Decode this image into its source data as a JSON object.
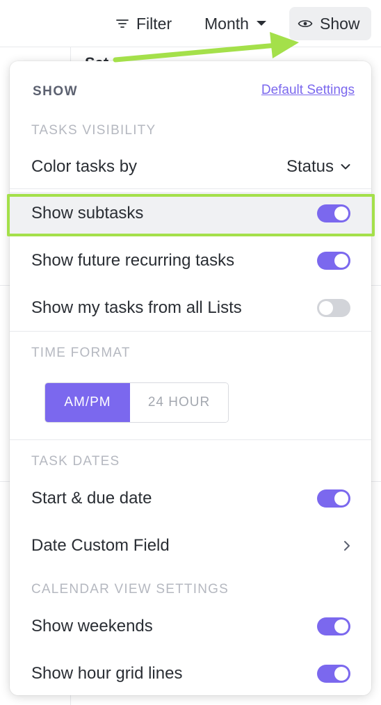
{
  "toolbar": {
    "filter_label": "Filter",
    "month_label": "Month",
    "show_label": "Show"
  },
  "background": {
    "day_label": "Sat"
  },
  "panel": {
    "title": "SHOW",
    "default_settings_link": "Default Settings",
    "tasks_visibility": {
      "heading": "TASKS VISIBILITY",
      "color_tasks_by": {
        "label": "Color tasks by",
        "value": "Status"
      },
      "show_subtasks": {
        "label": "Show subtasks",
        "on": true
      },
      "show_future_recurring": {
        "label": "Show future recurring tasks",
        "on": true
      },
      "show_my_tasks_all_lists": {
        "label": "Show my tasks from all Lists",
        "on": false
      }
    },
    "time_format": {
      "heading": "TIME FORMAT",
      "options": [
        "AM/PM",
        "24 HOUR"
      ],
      "selected": "AM/PM"
    },
    "task_dates": {
      "heading": "TASK DATES",
      "start_due_date": {
        "label": "Start & due date",
        "on": true
      },
      "date_custom_field": {
        "label": "Date Custom Field"
      }
    },
    "calendar_view_settings": {
      "heading": "CALENDAR VIEW SETTINGS",
      "show_weekends": {
        "label": "Show weekends",
        "on": true
      },
      "show_hour_grid_lines": {
        "label": "Show hour grid lines",
        "on": true
      }
    }
  },
  "colors": {
    "accent": "#7b68ee",
    "annotation": "#a4e04a",
    "toggle_off": "#d2d4d9"
  }
}
